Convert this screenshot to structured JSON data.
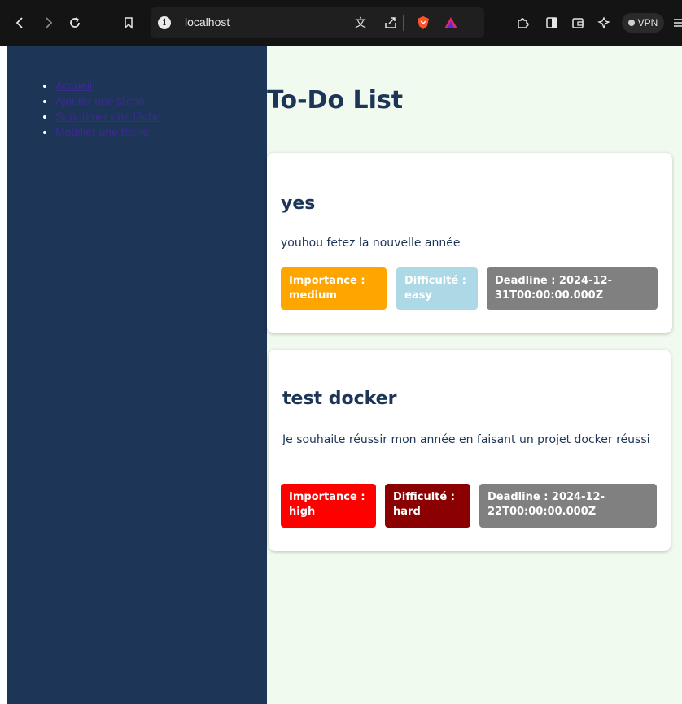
{
  "browser": {
    "url": "localhost",
    "vpn_label": "VPN"
  },
  "sidebar": {
    "links": [
      {
        "label": "Accueil"
      },
      {
        "label": "Ajouter une tâche"
      },
      {
        "label": "Supprimer une tâche"
      },
      {
        "label": "Modifier une tâche"
      }
    ]
  },
  "main": {
    "title": "To-Do List"
  },
  "tasks": [
    {
      "title": "yes",
      "description": "youhou fetez la nouvelle année",
      "importance_label": "Importance : medium",
      "difficulty_label": "Difficulté : easy",
      "deadline_label": "Deadline : 2024-12-31T00:00:00.000Z",
      "importance_color": "#ffa500",
      "difficulty_color": "#add8e6",
      "deadline_color": "#808080"
    },
    {
      "title": "test docker",
      "description": "Je souhaite réussir mon année en faisant un projet docker réussi",
      "importance_label": "Importance : high",
      "difficulty_label": "Difficulté : hard",
      "deadline_label": "Deadline : 2024-12-22T00:00:00.000Z",
      "importance_color": "#ff0000",
      "difficulty_color": "#8b0000",
      "deadline_color": "#808080"
    }
  ],
  "colors": {
    "sidebar_bg": "#1d3557",
    "main_bg": "#f1faee",
    "heading": "#1d3557",
    "link": "#3b2a8f"
  },
  "icons": [
    "back-icon",
    "forward-icon",
    "reload-icon",
    "bookmark-icon",
    "info-icon",
    "translate-icon",
    "share-icon",
    "brave-shield-icon",
    "brave-rewards-icon",
    "extensions-icon",
    "sidebar-toggle-icon",
    "wallet-icon",
    "leo-icon",
    "menu-icon"
  ]
}
